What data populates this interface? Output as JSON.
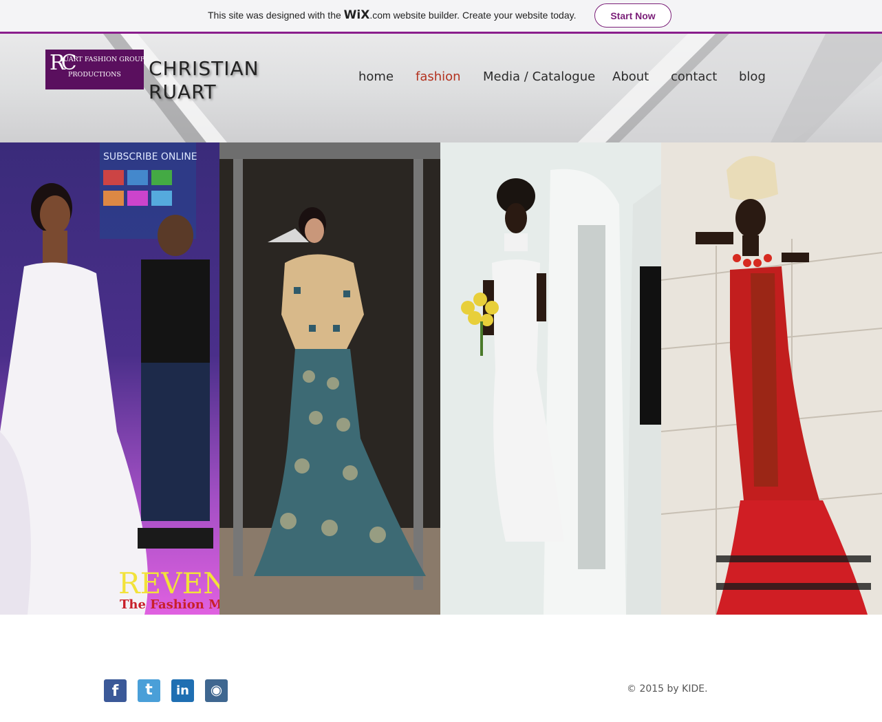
{
  "wix_banner": {
    "text_before": "This site was designed with the ",
    "logo": "WiX",
    "text_after": ".com website builder. Create your website today.",
    "cta_label": "Start Now"
  },
  "header": {
    "logo_line1": "UART FASHION GROUP",
    "logo_line2": "PRODUCTIONS",
    "logo_initials": "RC",
    "brand_line1": "CHRISTIAN",
    "brand_line2": "RUART"
  },
  "nav": [
    {
      "label": "home",
      "active": false
    },
    {
      "label": "fashion",
      "active": true
    },
    {
      "label": "Media / Catalogue",
      "active": false
    },
    {
      "label": "About",
      "active": false
    },
    {
      "label": "contact",
      "active": false
    },
    {
      "label": "blog",
      "active": false
    }
  ],
  "gallery": {
    "panel1_caption_big": "REVEN",
    "panel1_caption_small": "The Fashion Ma",
    "panel1_screen_text": "SUBSCRIBE ONLINE"
  },
  "footer": {
    "social": [
      {
        "name": "facebook-icon",
        "glyph": "f",
        "color": "#3b5998"
      },
      {
        "name": "twitter-icon",
        "glyph": "t",
        "color": "#4a9fd8"
      },
      {
        "name": "linkedin-icon",
        "glyph": "in",
        "color": "#1f6fb2"
      },
      {
        "name": "instagram-icon",
        "glyph": "◉",
        "color": "#3f6790"
      }
    ],
    "copyright": "© 2015 by KIDE."
  }
}
